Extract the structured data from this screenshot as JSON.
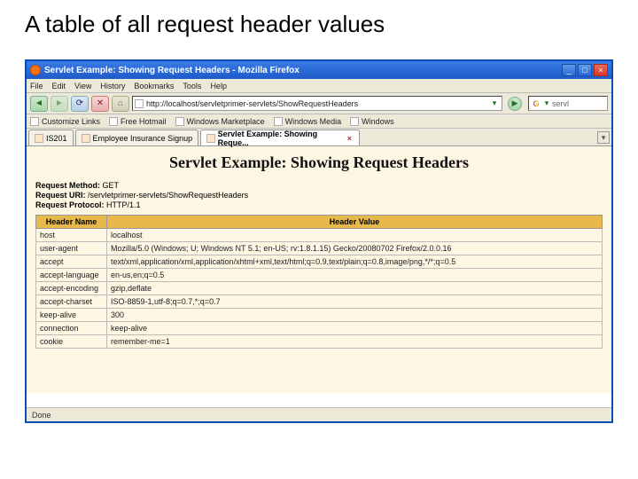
{
  "slide": {
    "title": "A table of all request header values"
  },
  "window": {
    "title": "Servlet Example: Showing Request Headers - Mozilla Firefox",
    "minimize": "_",
    "maximize": "□",
    "close": "×"
  },
  "menu": {
    "items": [
      "File",
      "Edit",
      "View",
      "History",
      "Bookmarks",
      "Tools",
      "Help"
    ]
  },
  "nav": {
    "back": "◄",
    "forward": "►",
    "reload": "⟳",
    "stop": "✕",
    "home": "⌂",
    "url": "http://localhost/servletprimer-servlets/ShowRequestHeaders",
    "go": "▶"
  },
  "search": {
    "engine_glyph": "G",
    "placeholder": "servl",
    "dd": "▾"
  },
  "bookmarks": {
    "items": [
      "Customize Links",
      "Free Hotmail",
      "Windows Marketplace",
      "Windows Media",
      "Windows"
    ]
  },
  "tabs": {
    "items": [
      {
        "label": "IS201",
        "active": false
      },
      {
        "label": "Employee Insurance Signup",
        "active": false
      },
      {
        "label": "Servlet Example: Showing Reque...",
        "active": true
      }
    ],
    "close_glyph": "×",
    "dd": "▾"
  },
  "page": {
    "heading": "Servlet Example: Showing Request Headers",
    "request_method_label": "Request Method:",
    "request_method_value": "GET",
    "request_uri_label": "Request URI:",
    "request_uri_value": "/servletprimer-servlets/ShowRequestHeaders",
    "request_protocol_label": "Request Protocol:",
    "request_protocol_value": "HTTP/1.1",
    "col1": "Header Name",
    "col2": "Header Value",
    "headers": [
      {
        "name": "host",
        "value": "localhost"
      },
      {
        "name": "user-agent",
        "value": "Mozilla/5.0 (Windows; U; Windows NT 5.1; en-US; rv:1.8.1.15) Gecko/20080702 Firefox/2.0.0.16"
      },
      {
        "name": "accept",
        "value": "text/xml,application/xml,application/xhtml+xml,text/html;q=0.9,text/plain;q=0.8,image/png,*/*;q=0.5"
      },
      {
        "name": "accept-language",
        "value": "en-us,en;q=0.5"
      },
      {
        "name": "accept-encoding",
        "value": "gzip,deflate"
      },
      {
        "name": "accept-charset",
        "value": "ISO-8859-1,utf-8;q=0.7,*;q=0.7"
      },
      {
        "name": "keep-alive",
        "value": "300"
      },
      {
        "name": "connection",
        "value": "keep-alive"
      },
      {
        "name": "cookie",
        "value": "remember-me=1"
      }
    ]
  },
  "status": {
    "text": "Done"
  }
}
